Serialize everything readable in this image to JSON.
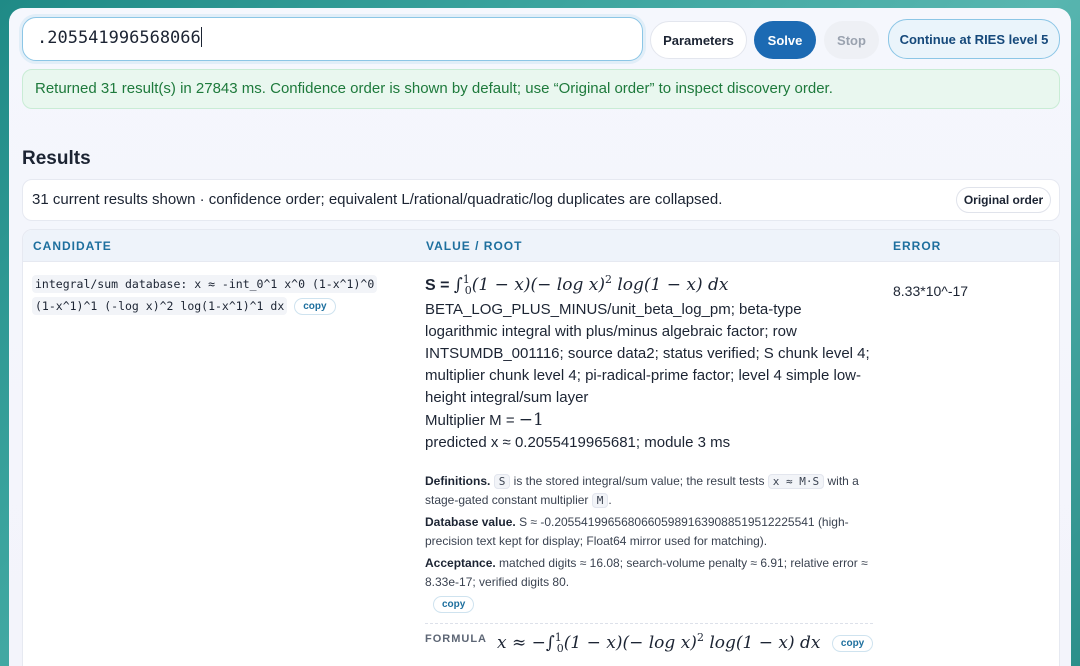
{
  "topbar": {
    "input_value": ".205541996568066",
    "parameters_label": "Parameters",
    "solve_label": "Solve",
    "stop_label": "Stop",
    "continue_label": "Continue at RIES level 5"
  },
  "status_message": "Returned 31 result(s) in 27843 ms. Confidence order is shown by default; use “Original order” to inspect discovery order.",
  "results": {
    "title": "Results",
    "summary": "31 current results shown · confidence order; equivalent L/rational/quadratic/log duplicates are collapsed.",
    "original_order_label": "Original order",
    "columns": [
      "CANDIDATE",
      "VALUE / ROOT",
      "ERROR"
    ],
    "row": {
      "candidate_line1": "integral/sum database: x ≈ -int_0^1 x^0 (1-x^1)^0",
      "candidate_line2": "(1-x^1)^1 (-log x)^2 log(1-x^1)^1 dx",
      "copy_label": "copy",
      "s_prefix": "S =",
      "s_integral": "∫",
      "s_upper": "1",
      "s_lower": "0",
      "s_body": "(1 − x)(− log x)",
      "s_exp": "2",
      "s_tail": " log(1 − x) dx",
      "description": "BETA_LOG_PLUS_MINUS/unit_beta_log_pm; beta-type logarithmic integral with plus/minus algebraic factor; row INTSUMDB_001116; source data2; status verified; S chunk level 4; multiplier chunk level 4; pi-radical-prime factor; level 4 simple low-height integral/sum layer",
      "multiplier_label": "Multiplier M =",
      "multiplier_value": "−1",
      "predicted": "predicted x ≈ 0.2055419965681; module 3 ms",
      "definitions_label": "Definitions.",
      "def_chip_s": "S",
      "def_text1": "is the stored integral/sum value; the result tests",
      "def_chip_expr": "x ≈ M·S",
      "def_text2": "with a stage-gated constant multiplier",
      "def_chip_m": "M",
      "def_text3": ".",
      "database_label": "Database value.",
      "database_text": "S ≈ -0.205541996568066059891639088519512225541 (high-precision text kept for display; Float64 mirror used for matching).",
      "acceptance_label": "Acceptance.",
      "acceptance_text": "matched digits ≈ 16.08; search-volume penalty ≈ 6.91; relative error ≈ 8.33e-17; verified digits 80.",
      "formula_label": "FORMULA",
      "formula_prefix": "x ≈ −",
      "formula_body": "(1 − x)(− log x)",
      "formula_exp": "2",
      "formula_tail": " log(1 − x) dx",
      "error": "8.33*10^-17"
    }
  }
}
